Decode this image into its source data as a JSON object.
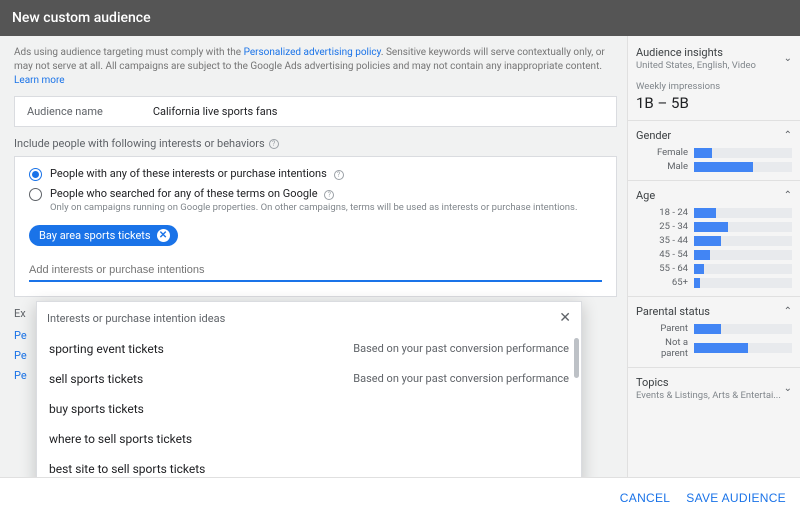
{
  "header": {
    "title": "New custom audience"
  },
  "policy": {
    "pre": "Ads using audience targeting must comply with the ",
    "link1": "Personalized advertising policy",
    "mid": ". Sensitive keywords will serve contextually only, or may not serve at all. All campaigns are subject to the Google Ads advertising policies and may not contain any inappropriate content. ",
    "link2": "Learn more"
  },
  "audience_name": {
    "label": "Audience name",
    "value": "California live sports fans"
  },
  "include_label": "Include people with following interests or behaviors",
  "radios": {
    "interests": "People with any of these interests or purchase intentions",
    "searched": "People who searched for any of these terms on Google",
    "searched_sub": "Only on campaigns running on Google properties. On other campaigns, terms will be used as interests or purchase intentions."
  },
  "chip": {
    "text": "Bay area sports tickets"
  },
  "input": {
    "placeholder": "Add interests or purchase intentions"
  },
  "excluded": {
    "label": "Ex"
  },
  "blue_links": [
    "Pe",
    "Pe",
    "Pe"
  ],
  "suggest": {
    "header": "Interests or purchase intention ideas",
    "items": [
      {
        "text": "sporting event tickets",
        "reason": "Based on your past conversion performance"
      },
      {
        "text": "sell sports tickets",
        "reason": "Based on your past conversion performance"
      },
      {
        "text": "buy sports tickets",
        "reason": ""
      },
      {
        "text": "where to sell sports tickets",
        "reason": ""
      },
      {
        "text": "best site to sell sports tickets",
        "reason": ""
      }
    ]
  },
  "insights": {
    "title": "Audience insights",
    "sub": "United States, English, Video",
    "impressions_label": "Weekly impressions",
    "impressions_value": "1B – 5B",
    "gender": {
      "title": "Gender",
      "rows": [
        {
          "label": "Female",
          "pct": 18
        },
        {
          "label": "Male",
          "pct": 60
        }
      ]
    },
    "age": {
      "title": "Age",
      "rows": [
        {
          "label": "18 - 24",
          "pct": 22
        },
        {
          "label": "25 - 34",
          "pct": 35
        },
        {
          "label": "35 - 44",
          "pct": 28
        },
        {
          "label": "45 - 54",
          "pct": 16
        },
        {
          "label": "55 - 64",
          "pct": 10
        },
        {
          "label": "65+",
          "pct": 6
        }
      ]
    },
    "parental": {
      "title": "Parental status",
      "rows": [
        {
          "label": "Parent",
          "pct": 28
        },
        {
          "label": "Not a parent",
          "pct": 55
        }
      ]
    },
    "topics": {
      "title": "Topics",
      "sub": "Events & Listings, Arts & Entertai..."
    }
  },
  "footer": {
    "cancel": "CANCEL",
    "save": "SAVE AUDIENCE"
  }
}
